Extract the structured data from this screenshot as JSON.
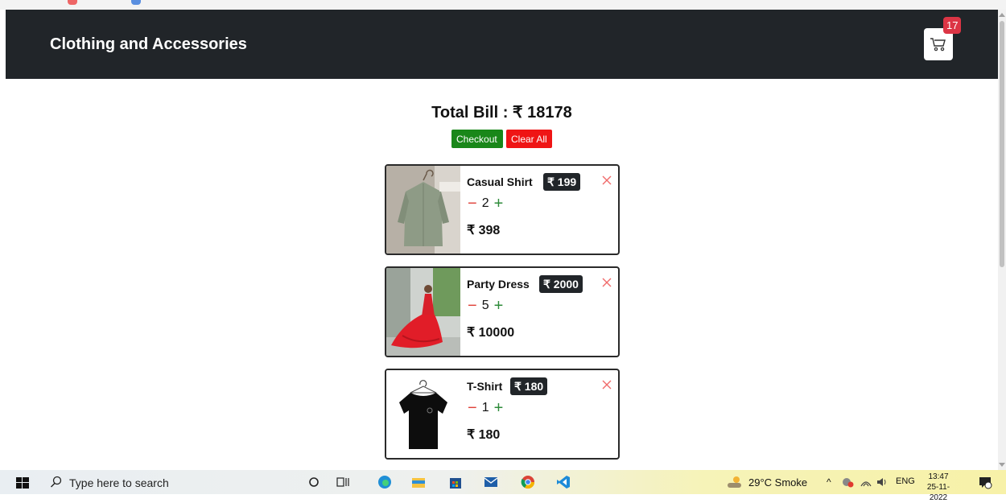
{
  "header": {
    "brand": "Clothing and Accessories",
    "cart_count": "17"
  },
  "summary": {
    "total_label": "Total Bill : ₹ 18178",
    "checkout_label": "Checkout",
    "clear_label": "Clear All"
  },
  "items": [
    {
      "name": "Casual Shirt",
      "price": "₹ 199",
      "qty": "2",
      "subtotal": "₹ 398"
    },
    {
      "name": "Party Dress",
      "price": "₹ 2000",
      "qty": "5",
      "subtotal": "₹ 10000"
    },
    {
      "name": "T-Shirt",
      "price": "₹ 180",
      "qty": "1",
      "subtotal": "₹ 180"
    }
  ],
  "taskbar": {
    "search_placeholder": "Type here to search",
    "weather": "29°C  Smoke",
    "language": "ENG",
    "time": "13:47",
    "date": "25-11-2022"
  },
  "colors": {
    "navbar": "#212529",
    "checkout": "#198719",
    "clear": "#ef1515",
    "badge": "#dc3545"
  }
}
